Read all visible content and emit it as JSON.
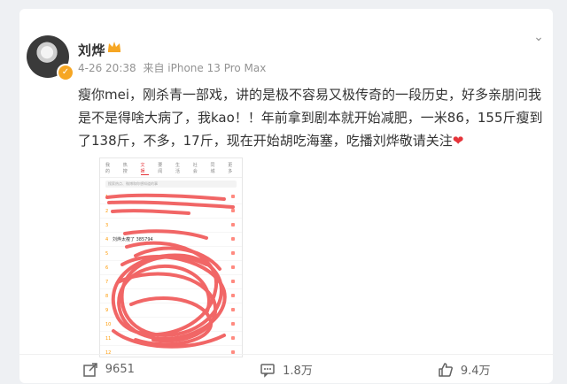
{
  "post": {
    "author": "刘烨",
    "time": "4-26 20:38",
    "source": "来自 iPhone 13 Pro Max",
    "text": "瘦你mei，刚杀青一部戏，讲的是极不容易又极传奇的一段历史，好多亲朋问我是不是得啥大病了，我kao！！年前拿到剧本就开始减肥，一米86，155斤瘦到了138斤，不多，17斤，现在开始胡吃海塞，吃播刘烨敬请关注",
    "emoji": "❤"
  },
  "embedded_screenshot": {
    "tabs": [
      "我的",
      "热搜",
      "文娱",
      "要闻",
      "生活",
      "社会",
      "同城",
      "更多"
    ],
    "search_placeholder": "搜索热点、微博和你想知道的事",
    "rows": [
      {
        "num": "1",
        "text": ""
      },
      {
        "num": "2",
        "text": ""
      },
      {
        "num": "3",
        "text": ""
      },
      {
        "num": "4",
        "text": "刘烨太瘦了 385794"
      },
      {
        "num": "5",
        "text": ""
      },
      {
        "num": "6",
        "text": ""
      },
      {
        "num": "7",
        "text": ""
      },
      {
        "num": "8",
        "text": ""
      },
      {
        "num": "9",
        "text": ""
      },
      {
        "num": "10",
        "text": ""
      },
      {
        "num": "11",
        "text": ""
      },
      {
        "num": "12",
        "text": ""
      },
      {
        "num": "13",
        "text": ""
      }
    ],
    "scribble_color": "#f05a5a"
  },
  "actions": {
    "share": "9651",
    "comment": "1.8万",
    "like": "9.4万"
  },
  "colors": {
    "accent": "#f6a623",
    "heart": "#e5343a",
    "text": "#333333",
    "meta": "#939393"
  }
}
